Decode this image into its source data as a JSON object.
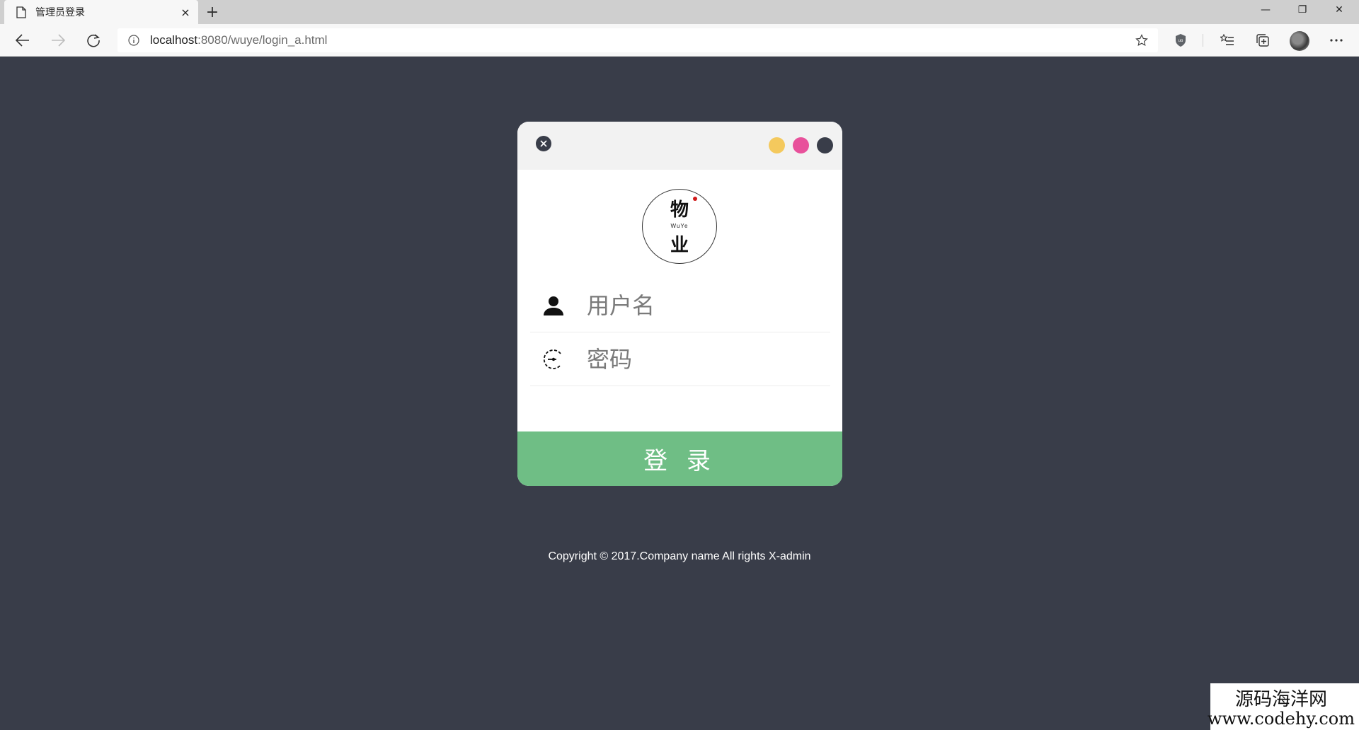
{
  "browser": {
    "tab_title": "管理员登录",
    "tab_close": "×",
    "new_tab": "+",
    "url_host": "localhost",
    "url_path": ":8080/wuye/login_a.html",
    "window": {
      "minimize": "—",
      "restore": "❐",
      "close": "✕"
    }
  },
  "login": {
    "logo_top": "物",
    "logo_mid": "WuYe",
    "logo_bottom": "业",
    "username_placeholder": "用户名",
    "password_placeholder": "密码",
    "submit_label": "登 录",
    "colors": {
      "accent_yellow": "#f4c95d",
      "accent_pink": "#e8519b",
      "accent_dark": "#393d49",
      "button_green": "#6fbe85"
    }
  },
  "footer": {
    "copyright": "Copyright © 2017.Company name All rights X-admin"
  },
  "watermark": {
    "cn": "源码海洋网",
    "en": "www.codehy.com"
  }
}
